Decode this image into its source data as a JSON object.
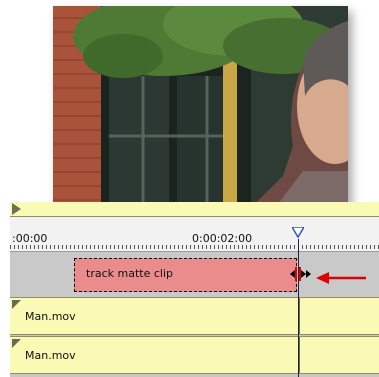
{
  "timeline": {
    "timecode_start": ":00:00",
    "timecode_mark": "0:00:02:00",
    "matte_clip_label": "track matte clip",
    "tracks": [
      {
        "clip_label": "Man.mov"
      },
      {
        "clip_label": "Man.mov"
      }
    ]
  },
  "colors": {
    "matte_clip": "#ea8c8c",
    "video_track": "#fafab4",
    "annotation_arrow": "#e00000",
    "cti_marker": "#3355cc"
  },
  "icons": {
    "playhead": "playhead-icon",
    "trim_cursor": "trim-cursor-icon",
    "annotation_arrow": "arrow-left-icon"
  }
}
